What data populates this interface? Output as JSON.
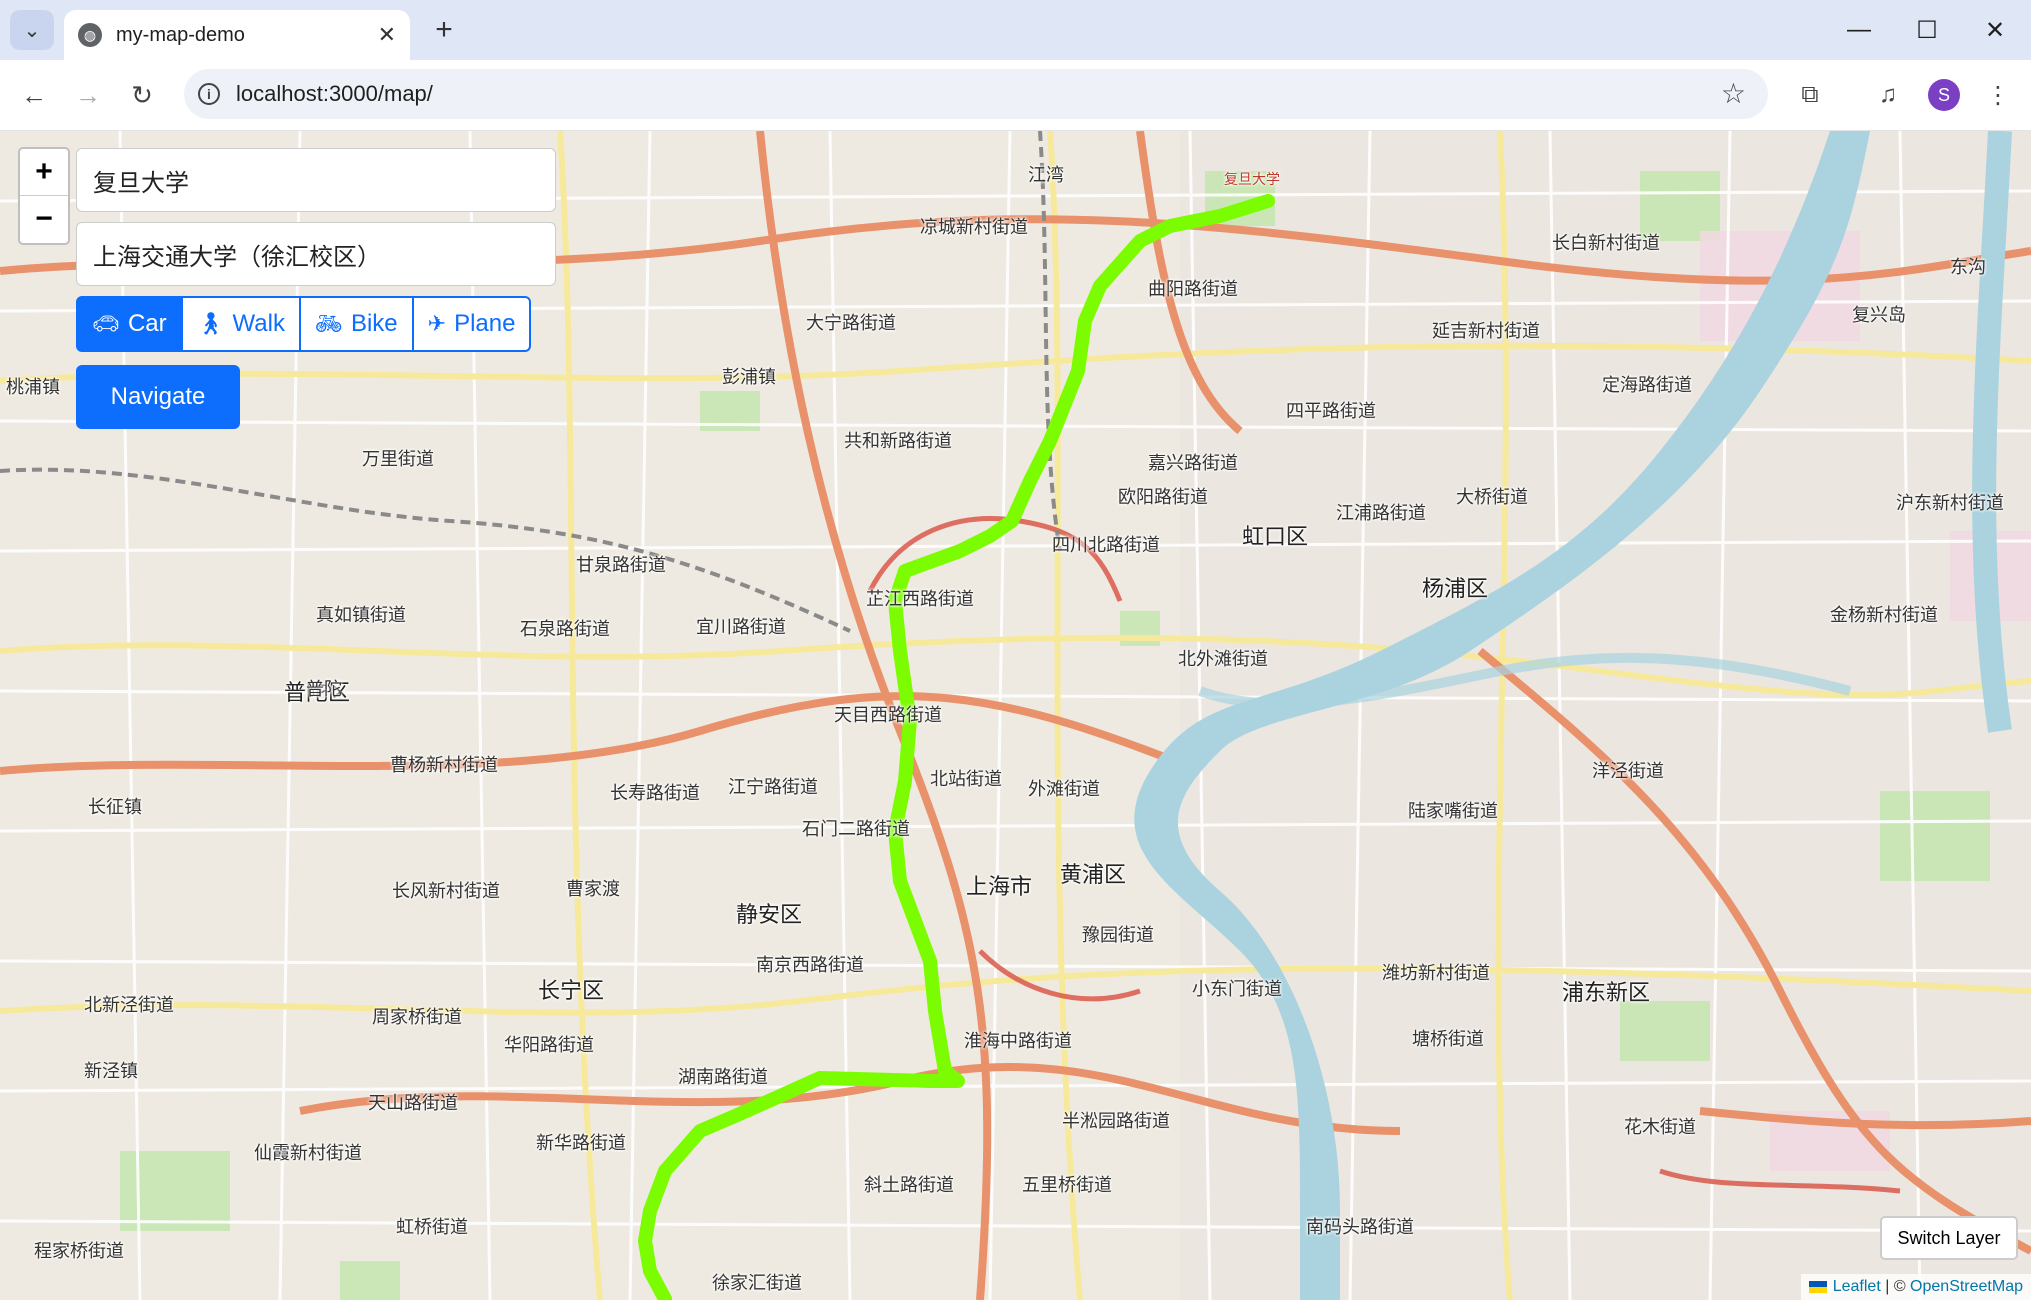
{
  "browser": {
    "tab_title": "my-map-demo",
    "url": "localhost:3000/map/",
    "profile_initial": "S"
  },
  "map": {
    "origin": "复旦大学",
    "destination": "上海交通大学（徐汇校区）",
    "modes": [
      {
        "label": "Car",
        "icon": "car-icon",
        "active": true
      },
      {
        "label": "Walk",
        "icon": "walk-icon",
        "active": false
      },
      {
        "label": "Bike",
        "icon": "bike-icon",
        "active": false
      },
      {
        "label": "Plane",
        "icon": "plane-icon",
        "active": false
      }
    ],
    "navigate_label": "Navigate",
    "zoom_in": "+",
    "zoom_out": "−",
    "switch_layer_label": "Switch Layer",
    "attribution": {
      "leaflet": "Leaflet",
      "separator": " | © ",
      "osm": "OpenStreetMap"
    },
    "route_color": "#7cfc00",
    "districts": [
      "普陀区",
      "静安区",
      "长宁区",
      "虹口区",
      "杨浦区",
      "黄浦区",
      "浦东新区",
      "上海市"
    ],
    "place_labels": [
      "彭浦镇",
      "万里街道",
      "甘泉路街道",
      "真如镇街道",
      "石泉路街道",
      "宜川路街道",
      "天目西路街道",
      "江宁路街道",
      "长寿路街道",
      "曹杨新村街道",
      "长风新村街道",
      "北新泾街道",
      "新泾镇",
      "天山路街道",
      "仙霞新村街道",
      "程家桥街道",
      "虹桥街道",
      "周家桥街道",
      "华阳路街道",
      "新华路街道",
      "湖南路街道",
      "淮海中路街道",
      "斜土路街道",
      "五里桥街道",
      "半淞园路街道",
      "小东门街道",
      "豫园街道",
      "外滩街道",
      "北站街道",
      "北外滩街道",
      "四川北路街道",
      "欧阳路街道",
      "嘉兴路街道",
      "四平路街道",
      "江浦路街道",
      "大桥街道",
      "定海路街道",
      "延吉新村街道",
      "长白新村街道",
      "曲阳路街道",
      "大宁路街道",
      "共和新路街道",
      "凉城新村街道",
      "江湾",
      "芷江西路街道",
      "石门二路街道",
      "南京西路街道",
      "曹家渡",
      "徐家汇街道",
      "金杨新村街道",
      "洋泾街道",
      "陆家嘴街道",
      "潍坊新村街道",
      "塘桥街道",
      "花木街道",
      "南码头路街道",
      "沪东新村街道",
      "桃浦镇",
      "长征镇",
      "复兴岛",
      "东沟",
      "普陀"
    ]
  }
}
